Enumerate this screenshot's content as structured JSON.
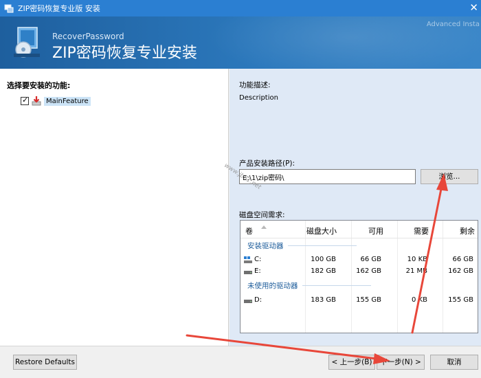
{
  "window": {
    "title": "ZIP密码恢复专业版 安装",
    "close_glyph": "✕"
  },
  "banner": {
    "vendor": "RecoverPassword",
    "product": "ZIP密码恢复专业安装",
    "watermark": "Advanced Insta"
  },
  "features": {
    "heading": "选择要安装的功能:",
    "items": [
      {
        "label": "MainFeature",
        "checked": true
      }
    ]
  },
  "details": {
    "desc_label": "功能描述:",
    "desc_text": "Description",
    "path_label": "产品安装路径(P):",
    "path_value": "E:\\1\\zip密码\\",
    "browse_label": "浏览...",
    "disk_label": "磁盘空间需求:"
  },
  "disk_table": {
    "headers": [
      "卷",
      "磁盘大小",
      "可用",
      "需要",
      "剩余"
    ],
    "groups": [
      {
        "title": "安装驱动器",
        "rows": [
          {
            "volume": "C:",
            "size": "100 GB",
            "available": "66 GB",
            "required": "10 KB",
            "remaining": "66 GB"
          },
          {
            "volume": "E:",
            "size": "182 GB",
            "available": "162 GB",
            "required": "21 MB",
            "remaining": "162 GB"
          }
        ]
      },
      {
        "title": "未使用的驱动器",
        "rows": [
          {
            "volume": "D:",
            "size": "183 GB",
            "available": "155 GB",
            "required": "0 KB",
            "remaining": "155 GB"
          }
        ]
      }
    ]
  },
  "footer": {
    "restore_label": "Restore Defaults",
    "back_label": "< 上一步(B)",
    "next_label": "下一步(N) >",
    "cancel_label": "取消"
  },
  "site_watermark": "www.jb51.net",
  "colors": {
    "titlebar": "#2b7fd2",
    "banner": "#2c79bd",
    "right_panel": "#dfe9f6",
    "annotation_arrow": "#e8473a"
  }
}
